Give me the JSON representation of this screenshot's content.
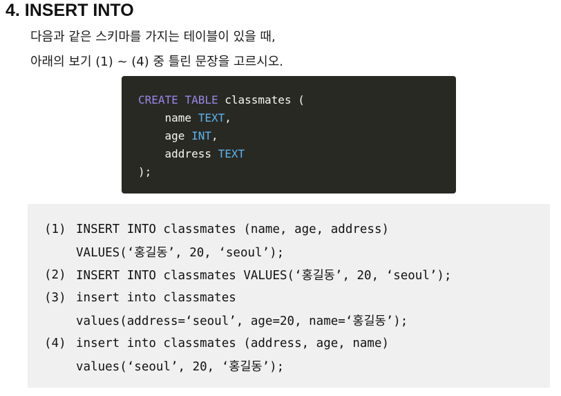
{
  "title": "4. INSERT INTO",
  "question": {
    "line1": "다음과 같은 스키마를 가지는 테이블이 있을 때,",
    "line2": "아래의 보기 (1) ~ (4) 중 틀린 문장을 고르시오."
  },
  "schema": {
    "line1": {
      "kw1": "CREATE",
      "kw2": "TABLE",
      "rest": " classmates ("
    },
    "line2": {
      "name": "name",
      "type": "TEXT",
      "tail": ","
    },
    "line3": {
      "name": "age",
      "type": "INT",
      "tail": ","
    },
    "line4": {
      "name": "address",
      "type": "TEXT",
      "tail": ""
    },
    "line5": ");"
  },
  "options": [
    {
      "num": "(1)",
      "line1": "INSERT INTO classmates (name, age, address)",
      "line2": "VALUES(‘홍길동’, 20, ‘seoul’);"
    },
    {
      "num": "(2)",
      "line1": "INSERT INTO classmates VALUES(‘홍길동’, 20, ‘seoul’);"
    },
    {
      "num": "(3)",
      "line1": "insert into classmates",
      "line2": "values(address=‘seoul’, age=20, name=‘홍길동’);"
    },
    {
      "num": "(4)",
      "line1": "insert into classmates (address, age, name)",
      "line2": "values(‘seoul’, 20, ‘홍길동’);"
    }
  ],
  "colors": {
    "code_bg": "#282923",
    "keyword": "#9b86e8",
    "type": "#5ab5f0",
    "answers_bg": "#f0f0f0"
  }
}
